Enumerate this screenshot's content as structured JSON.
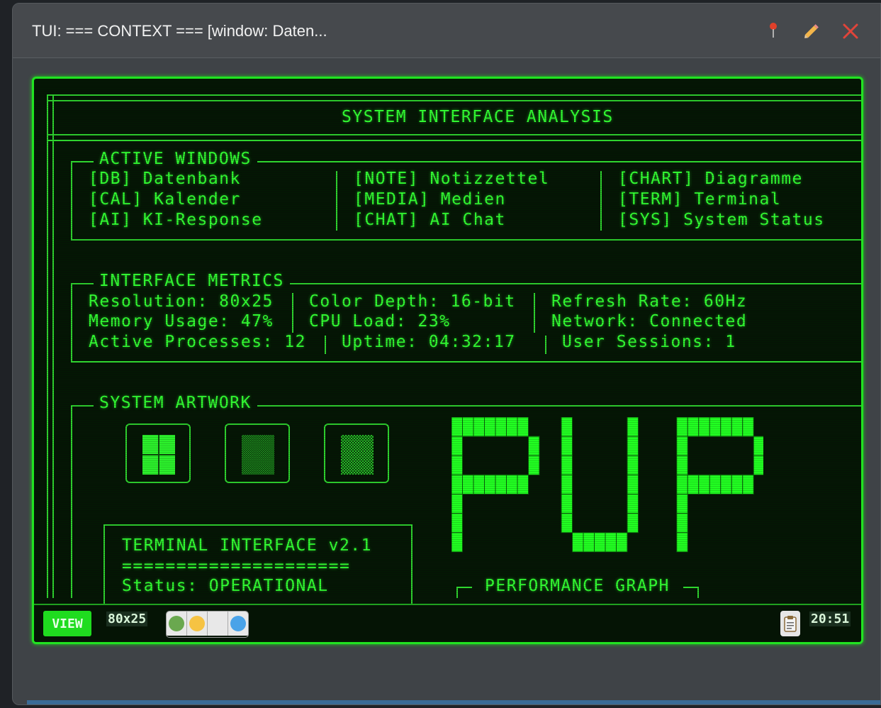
{
  "window": {
    "title": "TUI: === CONTEXT === [window: Daten...",
    "pin_icon": "pin-icon",
    "edit_icon": "pencil-icon",
    "close_icon": "close-icon"
  },
  "tui": {
    "header": "SYSTEM INTERFACE ANALYSIS",
    "active_windows": {
      "title": "ACTIVE WINDOWS",
      "rows": [
        [
          "[DB] Datenbank",
          "[NOTE] Notizzettel",
          "[CHART] Diagramme"
        ],
        [
          "[CAL] Kalender",
          "[MEDIA] Medien",
          "[TERM] Terminal"
        ],
        [
          "[AI] KI-Response",
          "[CHAT] AI Chat",
          "[SYS] System Status"
        ]
      ]
    },
    "metrics": {
      "title": "INTERFACE METRICS",
      "rows": [
        [
          "Resolution: 80x25",
          "Color Depth: 16-bit",
          "Refresh Rate: 60Hz"
        ],
        [
          "Memory Usage: 47%",
          "CPU Load: 23%",
          "Network: Connected"
        ],
        [
          "Active Processes: 12",
          "Uptime: 04:32:17",
          "User Sessions: 1"
        ]
      ]
    },
    "artwork": {
      "title": "SYSTEM ARTWORK",
      "logo_text": "PUP"
    },
    "terminal_box": {
      "title": "TERMINAL INTERFACE v2.1",
      "underline": "=====================",
      "status": "Status: OPERATIONAL"
    },
    "performance_graph": {
      "label": "PERFORMANCE GRAPH"
    }
  },
  "statusbar": {
    "view_label": "VIEW",
    "resolution": "80x25",
    "theme_colors": [
      "#6aa84f",
      "#f6c343",
      "#e8e8e8",
      "#4aa3e8"
    ],
    "clipboard_icon": "clipboard-icon",
    "clock": "20:51"
  },
  "colors": {
    "terminal_green": "#33ff33",
    "terminal_bg": "#051405",
    "accent_border": "#21e321"
  }
}
